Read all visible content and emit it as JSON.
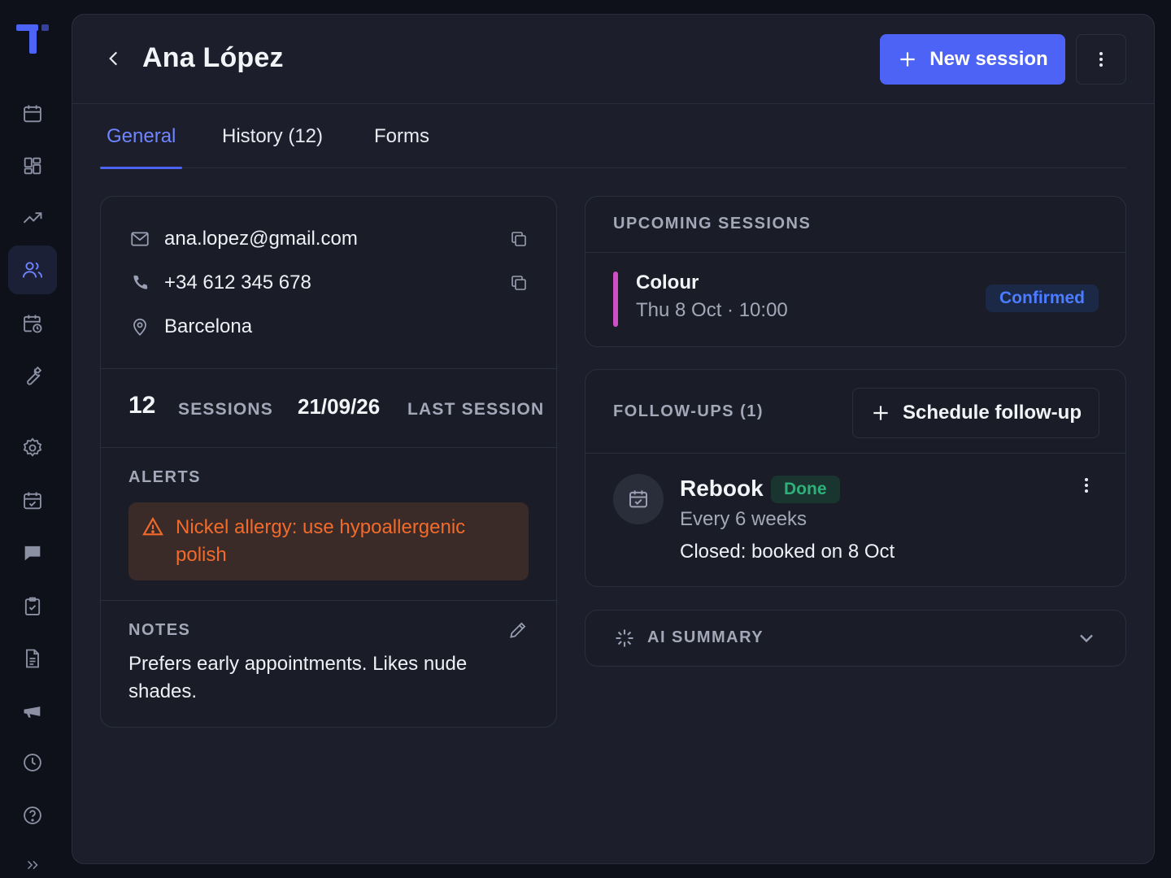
{
  "header": {
    "title": "Ana López",
    "new_session_label": "New session"
  },
  "tabs": [
    {
      "label": "General",
      "active": true
    },
    {
      "label": "History (12)",
      "active": false
    },
    {
      "label": "Forms",
      "active": false
    }
  ],
  "contact": {
    "email": "ana.lopez@gmail.com",
    "phone": "+34 612 345 678",
    "location": "Barcelona"
  },
  "stats": {
    "sessions_count": "12",
    "sessions_label": "SESSIONS",
    "last_session_date": "21/09/26",
    "last_session_label": "LAST SESSION"
  },
  "alerts": {
    "label": "ALERTS",
    "text": "Nickel allergy: use hypoallergenic polish"
  },
  "notes": {
    "label": "NOTES",
    "text": "Prefers early appointments. Likes nude shades."
  },
  "upcoming": {
    "title": "UPCOMING SESSIONS",
    "session_name": "Colour",
    "session_time": "Thu 8 Oct · 10:00",
    "status": "Confirmed",
    "accent": "#d14fc4"
  },
  "followups": {
    "title": "FOLLOW-UPS (1)",
    "schedule_label": "Schedule follow-up",
    "item_title": "Rebook",
    "item_status": "Done",
    "item_frequency": "Every 6 weeks",
    "item_closed": "Closed: booked on 8 Oct"
  },
  "ai_summary": {
    "label": "AI SUMMARY"
  },
  "colors": {
    "primary": "#4c63f5",
    "alert": "#f26b2a",
    "confirmed": "#4c7cff",
    "done": "#2fb07a"
  },
  "sidebar_icons": [
    "calendar-icon",
    "dashboard-icon",
    "trending-icon",
    "clients-icon",
    "schedule-icon",
    "wrench-icon",
    "settings-icon",
    "calendar-check-icon",
    "chat-icon",
    "clipboard-icon",
    "document-icon",
    "megaphone-icon",
    "clock-icon",
    "help-icon",
    "expand-icon"
  ]
}
